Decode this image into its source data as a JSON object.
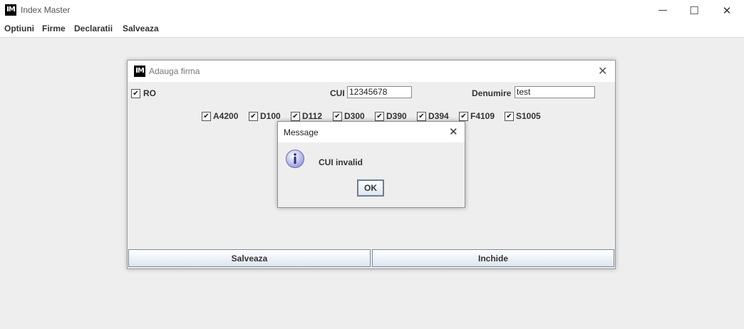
{
  "app": {
    "logo_text": "IM",
    "title": "Index Master",
    "minimize_glyph": "—",
    "maximize_glyph": "☐",
    "close_glyph": "✕"
  },
  "menu": [
    {
      "label": "Optiuni"
    },
    {
      "label": "Firme"
    },
    {
      "label": "Declaratii"
    },
    {
      "label": "Salveaza"
    }
  ],
  "dialog": {
    "logo_text": "IM",
    "title": "Adauga firma",
    "close_glyph": "✕",
    "ro_checkbox": {
      "label": "RO",
      "checked": true
    },
    "cui": {
      "label": "CUI",
      "value": "12345678"
    },
    "denumire": {
      "label": "Denumire",
      "value": "test"
    },
    "declarations": [
      {
        "label": "A4200",
        "checked": true
      },
      {
        "label": "D100",
        "checked": true
      },
      {
        "label": "D112",
        "checked": true
      },
      {
        "label": "D300",
        "checked": true
      },
      {
        "label": "D390",
        "checked": true
      },
      {
        "label": "D394",
        "checked": true
      },
      {
        "label": "F4109",
        "checked": true
      },
      {
        "label": "S1005",
        "checked": true
      }
    ],
    "check_glyph": "✔",
    "save_button": "Salveaza",
    "close_button": "Inchide"
  },
  "message": {
    "title": "Message",
    "close_glyph": "✕",
    "icon": "info-icon",
    "text": "CUI invalid",
    "ok_button": "OK"
  }
}
